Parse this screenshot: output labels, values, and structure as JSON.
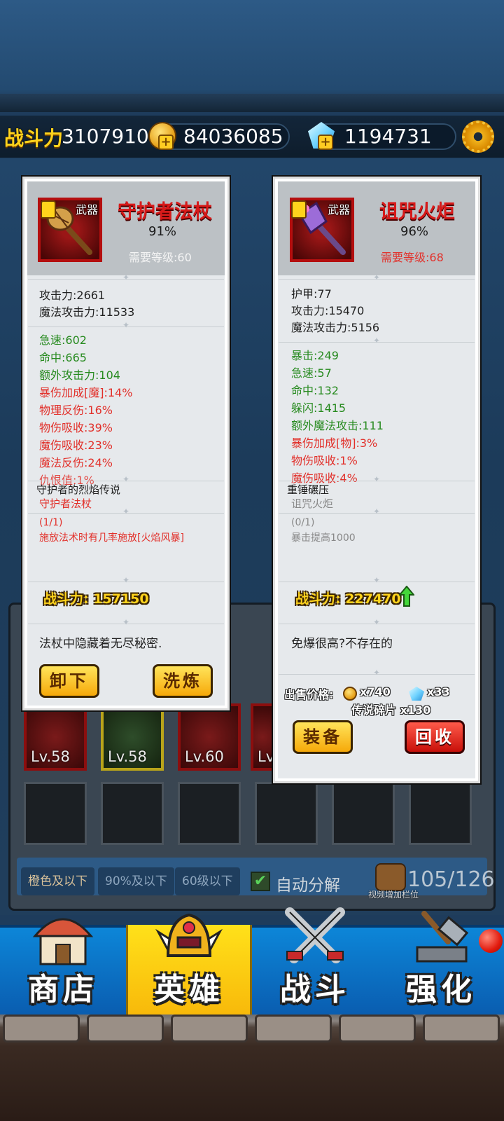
{
  "header": {
    "power_label": "战斗力",
    "power_value": "3107910",
    "gold": "84036085",
    "gems": "1194731"
  },
  "left_item": {
    "type": "武器",
    "name": "守护者法杖",
    "quality": "91%",
    "level_req": "需要等级:60",
    "base_stats": [
      "攻击力:2661",
      "魔法攻击力:11533"
    ],
    "extra_stats": [
      {
        "text": "急速:602",
        "color": "green"
      },
      {
        "text": "命中:665",
        "color": "green"
      },
      {
        "text": "额外攻击力:104",
        "color": "green"
      },
      {
        "text": "暴伤加成[魔]:14%",
        "color": "red"
      },
      {
        "text": "物理反伤:16%",
        "color": "red"
      },
      {
        "text": "物伤吸收:39%",
        "color": "red"
      },
      {
        "text": "魔伤吸收:23%",
        "color": "red"
      },
      {
        "text": "魔法反伤:24%",
        "color": "red"
      },
      {
        "text": "仇恨值:1%",
        "color": "red"
      }
    ],
    "legend_title": "守护者的烈焰传说",
    "legend_item": "守护者法杖",
    "legend_count": "(1/1)",
    "legend_effect": "施放法术时有几率施放[火焰风暴]",
    "combat_power": "战斗力: 157150",
    "flavor": "法杖中隐藏着无尽秘密.",
    "btn_unequip": "卸下",
    "btn_refine": "洗炼"
  },
  "right_item": {
    "type": "武器",
    "name": "诅咒火炬",
    "quality": "96%",
    "level_req": "需要等级:68",
    "base_stats": [
      "护甲:77",
      "攻击力:15470",
      "魔法攻击力:5156"
    ],
    "extra_stats": [
      {
        "text": "暴击:249",
        "color": "green"
      },
      {
        "text": "急速:57",
        "color": "green"
      },
      {
        "text": "命中:132",
        "color": "green"
      },
      {
        "text": "躲闪:1415",
        "color": "green"
      },
      {
        "text": "额外魔法攻击:111",
        "color": "green"
      },
      {
        "text": "暴伤加成[物]:3%",
        "color": "red"
      },
      {
        "text": "物伤吸收:1%",
        "color": "red"
      },
      {
        "text": "魔伤吸收:4%",
        "color": "red"
      }
    ],
    "legend_title": "重锤碾压",
    "legend_item": "诅咒火炬",
    "legend_count": "(0/1)",
    "legend_effect": "暴击提高1000",
    "combat_power": "战斗力: 227470",
    "flavor": "免爆很高?不存在的",
    "sell_label": "出售价格:",
    "sell_gold": "x740",
    "sell_gem": "x33",
    "sell_shards": "传说碎片 x130",
    "btn_equip": "装备",
    "btn_recycle": "回收"
  },
  "inventory": {
    "levels": [
      "Lv.58",
      "Lv.58",
      "Lv.60",
      "Lv"
    ],
    "filters": [
      "橙色及以下",
      "90%及以下",
      "60级以下"
    ],
    "auto_decompose": "自动分解",
    "count": "105/126",
    "bag_hint": "视频增加栏位"
  },
  "nav": {
    "shop": "商店",
    "hero": "英雄",
    "battle": "战斗",
    "enhance": "强化"
  },
  "colors": {
    "gold_text": "#ffd31c",
    "item_name_red": "#d81a1a",
    "stat_green": "#268a1e",
    "stat_red": "#e2302a",
    "nav_blue": "#0d86d8",
    "nav_active": "#ffe11a"
  }
}
